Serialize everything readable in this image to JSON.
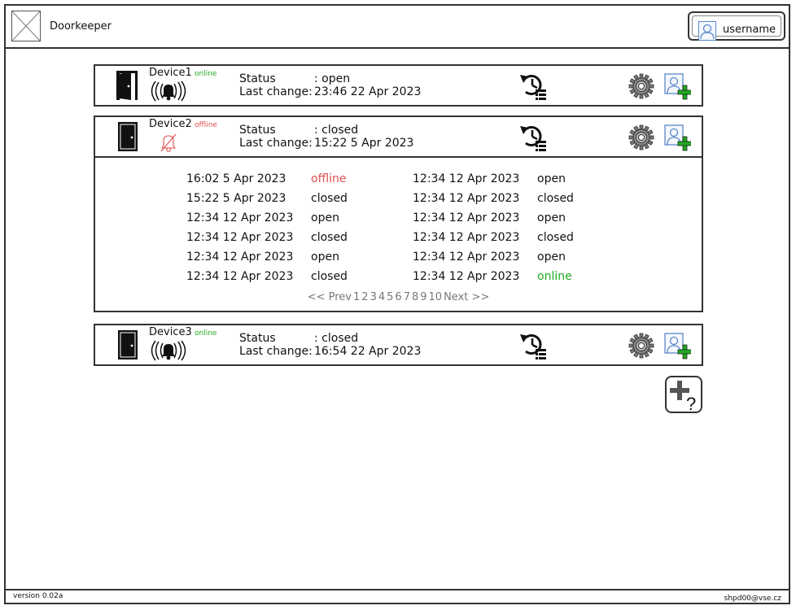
{
  "app": {
    "title": "Doorkeeper"
  },
  "user": {
    "name": "username",
    "icon": "user-avatar-icon"
  },
  "devices": [
    {
      "name": "Device1",
      "connection": "online",
      "door": "open",
      "alarm": "armed",
      "status_label": "Status",
      "status_value": ": open",
      "change_label": "Last change:",
      "change_value": "23:46 22 Apr 2023",
      "icons": [
        "door-open-icon",
        "alarm-bell-icon",
        "history-icon",
        "gear-icon",
        "add-user-icon"
      ]
    },
    {
      "name": "Device2",
      "connection": "offline",
      "door": "closed",
      "alarm": "disabled",
      "status_label": "Status",
      "status_value": ": closed",
      "change_label": "Last change:",
      "change_value": "15:22 5 Apr 2023",
      "icons": [
        "door-closed-icon",
        "alarm-off-icon",
        "history-icon",
        "gear-icon",
        "add-user-icon"
      ],
      "history": {
        "left": [
          {
            "time": "16:02 5 Apr 2023",
            "state": "offline"
          },
          {
            "time": "15:22 5 Apr 2023",
            "state": "closed"
          },
          {
            "time": "12:34 12 Apr 2023",
            "state": "open"
          },
          {
            "time": "12:34 12 Apr 2023",
            "state": "closed"
          },
          {
            "time": "12:34 12 Apr 2023",
            "state": "open"
          },
          {
            "time": "12:34 12 Apr 2023",
            "state": "closed"
          }
        ],
        "right": [
          {
            "time": "12:34 12 Apr 2023",
            "state": "open"
          },
          {
            "time": "12:34 12 Apr 2023",
            "state": "closed"
          },
          {
            "time": "12:34 12 Apr 2023",
            "state": "open"
          },
          {
            "time": "12:34 12 Apr 2023",
            "state": "closed"
          },
          {
            "time": "12:34 12 Apr 2023",
            "state": "open"
          },
          {
            "time": "12:34 12 Apr 2023",
            "state": "online"
          }
        ],
        "pager": {
          "prev": "<< Prev",
          "pages": [
            "1",
            "2",
            "3",
            "4",
            "5",
            "6",
            "7",
            "8",
            "9",
            "10"
          ],
          "next": "Next >>"
        }
      }
    },
    {
      "name": "Device3",
      "connection": "online",
      "door": "closed",
      "alarm": "armed",
      "status_label": "Status",
      "status_value": ": closed",
      "change_label": "Last change:",
      "change_value": "16:54 22 Apr 2023",
      "icons": [
        "door-closed-icon",
        "alarm-bell-icon",
        "history-icon",
        "gear-icon",
        "add-user-icon"
      ]
    }
  ],
  "add_device": {
    "icon": "add-device-icon"
  },
  "footer": {
    "version": "version 0.02a",
    "email": "shpd00@vse.cz"
  },
  "colors": {
    "online": "#22aa22",
    "offline": "#e05050",
    "pager": "#777777",
    "add_user_plus": "#22aa22"
  }
}
